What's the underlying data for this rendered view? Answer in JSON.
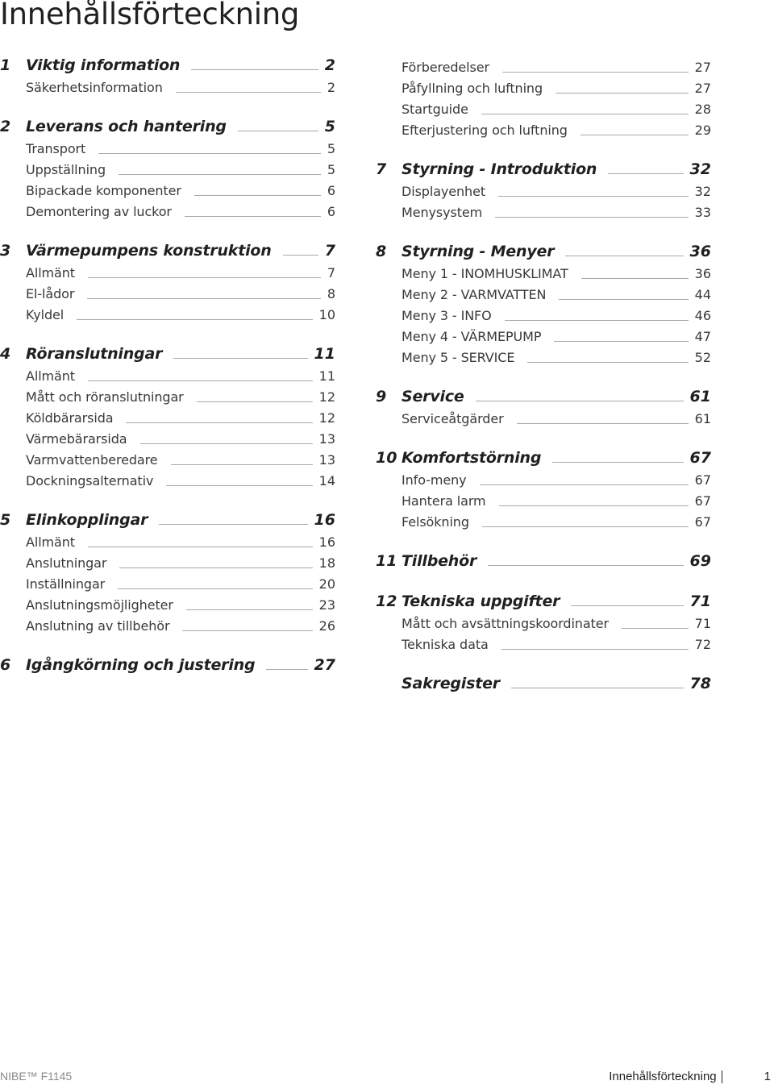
{
  "document": {
    "title": "Innehållsförteckning"
  },
  "toc": {
    "left": [
      {
        "type": "chapter",
        "num": "1",
        "label": "Viktig information",
        "page": "2"
      },
      {
        "type": "sub",
        "label": "Säkerhetsinformation",
        "page": "2"
      },
      {
        "type": "chapter",
        "num": "2",
        "label": "Leverans och hantering",
        "page": "5"
      },
      {
        "type": "sub",
        "label": "Transport",
        "page": "5"
      },
      {
        "type": "sub",
        "label": "Uppställning",
        "page": "5"
      },
      {
        "type": "sub",
        "label": "Bipackade komponenter",
        "page": "6"
      },
      {
        "type": "sub",
        "label": "Demontering av luckor",
        "page": "6"
      },
      {
        "type": "chapter",
        "num": "3",
        "label": "Värmepumpens konstruktion",
        "page": "7"
      },
      {
        "type": "sub",
        "label": "Allmänt",
        "page": "7"
      },
      {
        "type": "sub",
        "label": "El-lådor",
        "page": "8"
      },
      {
        "type": "sub",
        "label": "Kyldel",
        "page": "10"
      },
      {
        "type": "chapter",
        "num": "4",
        "label": "Röranslutningar",
        "page": "11"
      },
      {
        "type": "sub",
        "label": "Allmänt",
        "page": "11"
      },
      {
        "type": "sub",
        "label": "Mått och röranslutningar",
        "page": "12"
      },
      {
        "type": "sub",
        "label": "Köldbärarsida",
        "page": "12"
      },
      {
        "type": "sub",
        "label": "Värmebärarsida",
        "page": "13"
      },
      {
        "type": "sub",
        "label": "Varmvattenberedare",
        "page": "13"
      },
      {
        "type": "sub",
        "label": "Dockningsalternativ",
        "page": "14"
      },
      {
        "type": "chapter",
        "num": "5",
        "label": "Elinkopplingar",
        "page": "16"
      },
      {
        "type": "sub",
        "label": "Allmänt",
        "page": "16"
      },
      {
        "type": "sub",
        "label": "Anslutningar",
        "page": "18"
      },
      {
        "type": "sub",
        "label": "Inställningar",
        "page": "20"
      },
      {
        "type": "sub",
        "label": "Anslutningsmöjligheter",
        "page": "23"
      },
      {
        "type": "sub",
        "label": "Anslutning av tillbehör",
        "page": "26"
      },
      {
        "type": "chapter",
        "num": "6",
        "label": "Igångkörning och justering",
        "page": "27"
      }
    ],
    "right": [
      {
        "type": "sub",
        "label": "Förberedelser",
        "page": "27"
      },
      {
        "type": "sub",
        "label": "Påfyllning och luftning",
        "page": "27"
      },
      {
        "type": "sub",
        "label": "Startguide",
        "page": "28"
      },
      {
        "type": "sub",
        "label": "Efterjustering och luftning",
        "page": "29"
      },
      {
        "type": "chapter",
        "num": "7",
        "label": "Styrning - Introduktion",
        "page": "32"
      },
      {
        "type": "sub",
        "label": "Displayenhet",
        "page": "32"
      },
      {
        "type": "sub",
        "label": "Menysystem",
        "page": "33"
      },
      {
        "type": "chapter",
        "num": "8",
        "label": "Styrning - Menyer",
        "page": "36"
      },
      {
        "type": "sub",
        "label": "Meny 1 - INOMHUSKLIMAT",
        "page": "36"
      },
      {
        "type": "sub",
        "label": "Meny 2 - VARMVATTEN",
        "page": "44"
      },
      {
        "type": "sub",
        "label": "Meny 3 - INFO",
        "page": "46"
      },
      {
        "type": "sub",
        "label": "Meny 4 - VÄRMEPUMP",
        "page": "47"
      },
      {
        "type": "sub",
        "label": "Meny 5 - SERVICE",
        "page": "52"
      },
      {
        "type": "chapter",
        "num": "9",
        "label": "Service",
        "page": "61"
      },
      {
        "type": "sub",
        "label": "Serviceåtgärder",
        "page": "61"
      },
      {
        "type": "chapter",
        "num": "10",
        "label": "Komfortstörning",
        "page": "67"
      },
      {
        "type": "sub",
        "label": "Info-meny",
        "page": "67"
      },
      {
        "type": "sub",
        "label": "Hantera larm",
        "page": "67"
      },
      {
        "type": "sub",
        "label": "Felsökning",
        "page": "67"
      },
      {
        "type": "chapter",
        "num": "11",
        "label": "Tillbehör",
        "page": "69"
      },
      {
        "type": "chapter",
        "num": "12",
        "label": "Tekniska uppgifter",
        "page": "71"
      },
      {
        "type": "sub",
        "label": "Mått och avsättningskoordinater",
        "page": "71"
      },
      {
        "type": "sub",
        "label": "Tekniska data",
        "page": "72"
      },
      {
        "type": "chapter",
        "num": "",
        "label": "Sakregister",
        "page": "78"
      }
    ]
  },
  "footer": {
    "product": "NIBE™ F1145",
    "section": "Innehållsförteckning",
    "page_number": "1"
  }
}
